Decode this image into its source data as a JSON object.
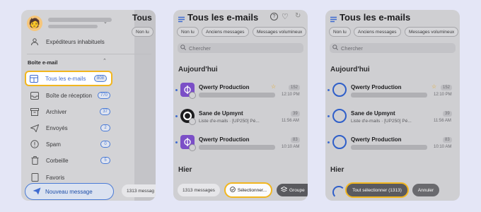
{
  "colors": {
    "accent": "#4a7bd6",
    "highlight": "#f2b61f",
    "brand_purple": "#7b4fc7",
    "background": "#e4e6f6"
  },
  "panel1": {
    "avatar_icon": "memoji-avatar",
    "chevron_icon": "chevron-down-icon",
    "unwanted_senders": "Expéditeurs inhabituels",
    "mailbox_header": "Boîte e-mail",
    "items": [
      {
        "label": "Tous les e-mails",
        "count": "808",
        "icon": "all-mail-icon"
      },
      {
        "label": "Boîte de réception",
        "count": "770",
        "icon": "inbox-icon"
      },
      {
        "label": "Archiver",
        "count": "37",
        "icon": "archive-icon"
      },
      {
        "label": "Envoyés",
        "count": "2",
        "icon": "sent-icon"
      },
      {
        "label": "Spam",
        "count": "0",
        "icon": "spam-icon"
      },
      {
        "label": "Corbeille",
        "count": "5",
        "icon": "trash-icon"
      },
      {
        "label": "Favoris",
        "count": "",
        "icon": "favorites-icon"
      }
    ],
    "new_message": "Nouveau message"
  },
  "panel2": {
    "title": "Tous les e-mails",
    "chips": [
      "Non lu",
      "Anciens messages",
      "Messages volumineux"
    ],
    "search_placeholder": "Chercher",
    "today": "Aujourd'hui",
    "emails": [
      {
        "sender": "Qwerty Production",
        "time": "12:10 PM",
        "badge": "152",
        "starred": true,
        "preview": ""
      },
      {
        "sender": "Sane de Upmynt",
        "time": "11:56 AM",
        "badge": "39",
        "starred": false,
        "preview": "Liste d'e-mails · [UP250] Pé..."
      },
      {
        "sender": "Qwerty Production",
        "time": "10:10 AM",
        "badge": "83",
        "starred": false,
        "preview": ""
      }
    ],
    "yesterday": "Hier",
    "count_pill": "1313 messages",
    "select_pill": "Sélectionner...",
    "group_pill": "Groupe"
  },
  "panel3": {
    "title": "Tous les e-mails",
    "chips": [
      "Non lu",
      "Anciens messages",
      "Messages volumineux"
    ],
    "search_placeholder": "Chercher",
    "today": "Aujourd'hui",
    "emails": [
      {
        "sender": "Qwerty Production",
        "time": "12:10 PM",
        "badge": "152",
        "starred": true,
        "preview": ""
      },
      {
        "sender": "Sane de Upmynt",
        "time": "11:56 AM",
        "badge": "39",
        "starred": false,
        "preview": "Liste d'e-mails · [UP250] Pé..."
      },
      {
        "sender": "Qwerty Production",
        "time": "10:10 AM",
        "badge": "83",
        "starred": false,
        "preview": ""
      }
    ],
    "yesterday": "Hier",
    "select_all_pill": "Tout sélectionner (1313)",
    "cancel_pill": "Annuler"
  },
  "panel1_partial": {
    "title_fragment": "Tous",
    "chip_fragment": "Non lu",
    "count_pill": "1313 messag"
  }
}
